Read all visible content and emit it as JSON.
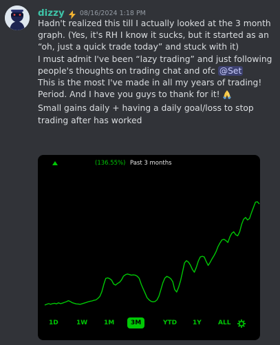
{
  "message": {
    "username": "dizzy",
    "timestamp": "08/16/2024 1:18 PM",
    "line1": "Hadn't realized this till I actually looked at the 3 month graph. (Yes, it's RH I know it sucks, but it started as an “oh, just a quick trade today” and stuck with it)",
    "line2": "I must admit I've been “lazy trading” and just following people's thoughts on trading chat and ofc",
    "mention": "@Set",
    "line3": "This is the most I've made in all my years of trading! Period. And I have you guys to thank for it!",
    "line4": "Small gains daily + having a daily goal/loss to stop trading after has worked"
  },
  "icons": {
    "boost": "lightning-bolt-icon",
    "emoji": "folded-hands-icon",
    "settings": "gear-icon",
    "trend": "up-arrow-icon"
  },
  "colors": {
    "username": "#3fc4a8",
    "accent_green": "#00c805",
    "background": "#313338"
  },
  "chart_header": {
    "percent": "(136.55%)",
    "period": "Past 3 months"
  },
  "range_tabs": [
    "1D",
    "1W",
    "1M",
    "3M",
    "YTD",
    "1Y",
    "ALL"
  ],
  "active_range": "3M",
  "chart_data": {
    "type": "line",
    "title": "",
    "xlabel": "",
    "ylabel": "",
    "grid": false,
    "series": [
      {
        "values": [
          10,
          10.5,
          11,
          10.5,
          11,
          11.2,
          10.8,
          11.5,
          11,
          11.3,
          11.8,
          12.3,
          13,
          12.4,
          11.6,
          11.2,
          10.8,
          10.7,
          10.5,
          10.9,
          11.3,
          11.7,
          12.2,
          12.5,
          12.8,
          13.2,
          13.5,
          14.5,
          15.8,
          19,
          24,
          28,
          28.4,
          27.8,
          26.8,
          24.2,
          23.5,
          24.6,
          25.4,
          27,
          29.5,
          30.5,
          31,
          30.6,
          30.2,
          30.4,
          30.2,
          29.5,
          28,
          24,
          21,
          18,
          15,
          13.5,
          12.5,
          12.2,
          12.4,
          13.5,
          16,
          20.5,
          25,
          28.2,
          29.4,
          28.8,
          27.8,
          25.8,
          20.5,
          18.8,
          22,
          26.5,
          32.5,
          38.5,
          40,
          39,
          37,
          34,
          32.2,
          35.5,
          39.8,
          42.5,
          43,
          42.5,
          39.5,
          36.8,
          38.8,
          41.3,
          43.5,
          46,
          49.5,
          52,
          54,
          54.5,
          53.6,
          52.3,
          56,
          58.5,
          59.5,
          57.5,
          56.8,
          59.5,
          64.5,
          68,
          69.2,
          67.5,
          68.5,
          72.5,
          76,
          79.5,
          79.8,
          78.3
        ]
      }
    ]
  }
}
